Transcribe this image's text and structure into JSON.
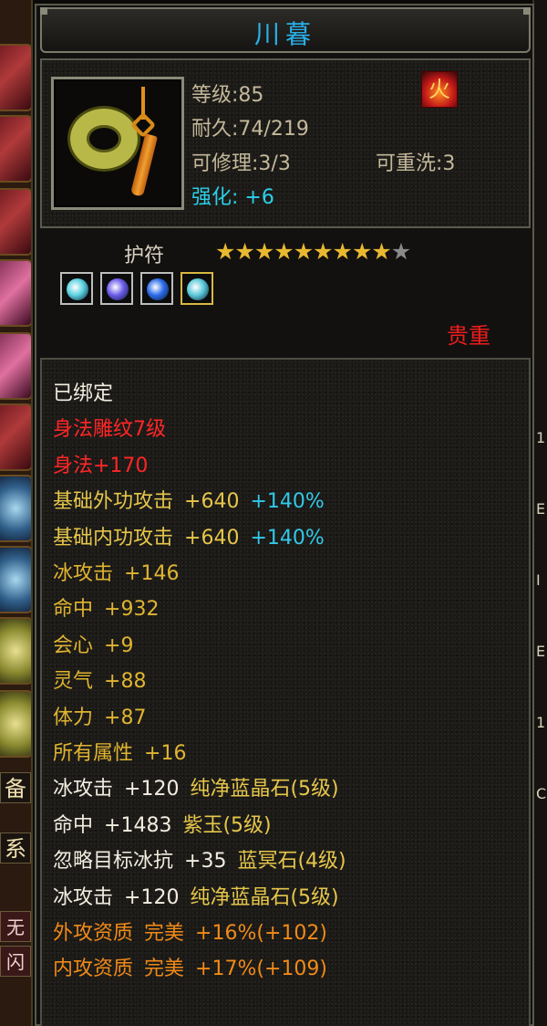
{
  "item": {
    "name": "川暮",
    "level": "等级:85",
    "durability": "耐久:74/219",
    "repairable": "可修理:3/3",
    "rewash": "可重洗:3",
    "enhance": "强化: +6",
    "type": "护符",
    "stars_filled": 9,
    "stars_total": 10,
    "rarity": "贵重",
    "quality_badge_glyph": "火"
  },
  "gems": [
    {
      "name": "cyan-gem",
      "color": "#5ad0e0"
    },
    {
      "name": "violet-gem",
      "color": "#6a5ae8"
    },
    {
      "name": "blue-gem",
      "color": "#2a6ae8"
    },
    {
      "name": "teal-gem",
      "color": "#5ac8d8"
    }
  ],
  "properties": [
    {
      "cls": "c-white",
      "parts": [
        "已绑定"
      ]
    },
    {
      "cls": "c-red",
      "parts": [
        "身法雕纹7级"
      ]
    },
    {
      "cls": "c-red",
      "parts": [
        "身法+170"
      ]
    },
    {
      "cls": "c-lgold",
      "parts": [
        "基础外功攻击",
        "+640"
      ],
      "extra": "+140%"
    },
    {
      "cls": "c-lgold",
      "parts": [
        "基础内功攻击",
        "+640"
      ],
      "extra": "+140%"
    },
    {
      "cls": "c-gold",
      "parts": [
        "冰攻击",
        "+146"
      ]
    },
    {
      "cls": "c-gold",
      "parts": [
        "命中",
        "+932"
      ]
    },
    {
      "cls": "c-gold",
      "parts": [
        "会心",
        "+9"
      ]
    },
    {
      "cls": "c-gold",
      "parts": [
        "灵气",
        "+88"
      ]
    },
    {
      "cls": "c-gold",
      "parts": [
        "体力",
        "+87"
      ]
    },
    {
      "cls": "c-gold",
      "parts": [
        "所有属性",
        "+16"
      ]
    },
    {
      "cls": "c-white",
      "parts": [
        "冰攻击",
        "+120"
      ],
      "gem": "纯净蓝晶石(5级)"
    },
    {
      "cls": "c-white",
      "parts": [
        "命中",
        "+1483"
      ],
      "gem": "紫玉(5级)"
    },
    {
      "cls": "c-white",
      "parts": [
        "忽略目标冰抗",
        "+35"
      ],
      "gem": "蓝冥石(4级)"
    },
    {
      "cls": "c-white",
      "parts": [
        "冰攻击",
        "+120"
      ],
      "gem": "纯净蓝晶石(5级)"
    },
    {
      "cls": "c-orange",
      "parts": [
        "外攻资质",
        "完美",
        "+16%(+102)"
      ]
    },
    {
      "cls": "c-orange",
      "parts": [
        "内攻资质",
        "完美",
        "+17%(+109)"
      ]
    }
  ],
  "left_panel": {
    "tab_equipment": "备",
    "tab_new": "系",
    "label_a": "无",
    "label_b": "闪"
  },
  "right_panel": {
    "chars": [
      "1",
      "E",
      "I",
      "E",
      "1",
      "C"
    ]
  }
}
